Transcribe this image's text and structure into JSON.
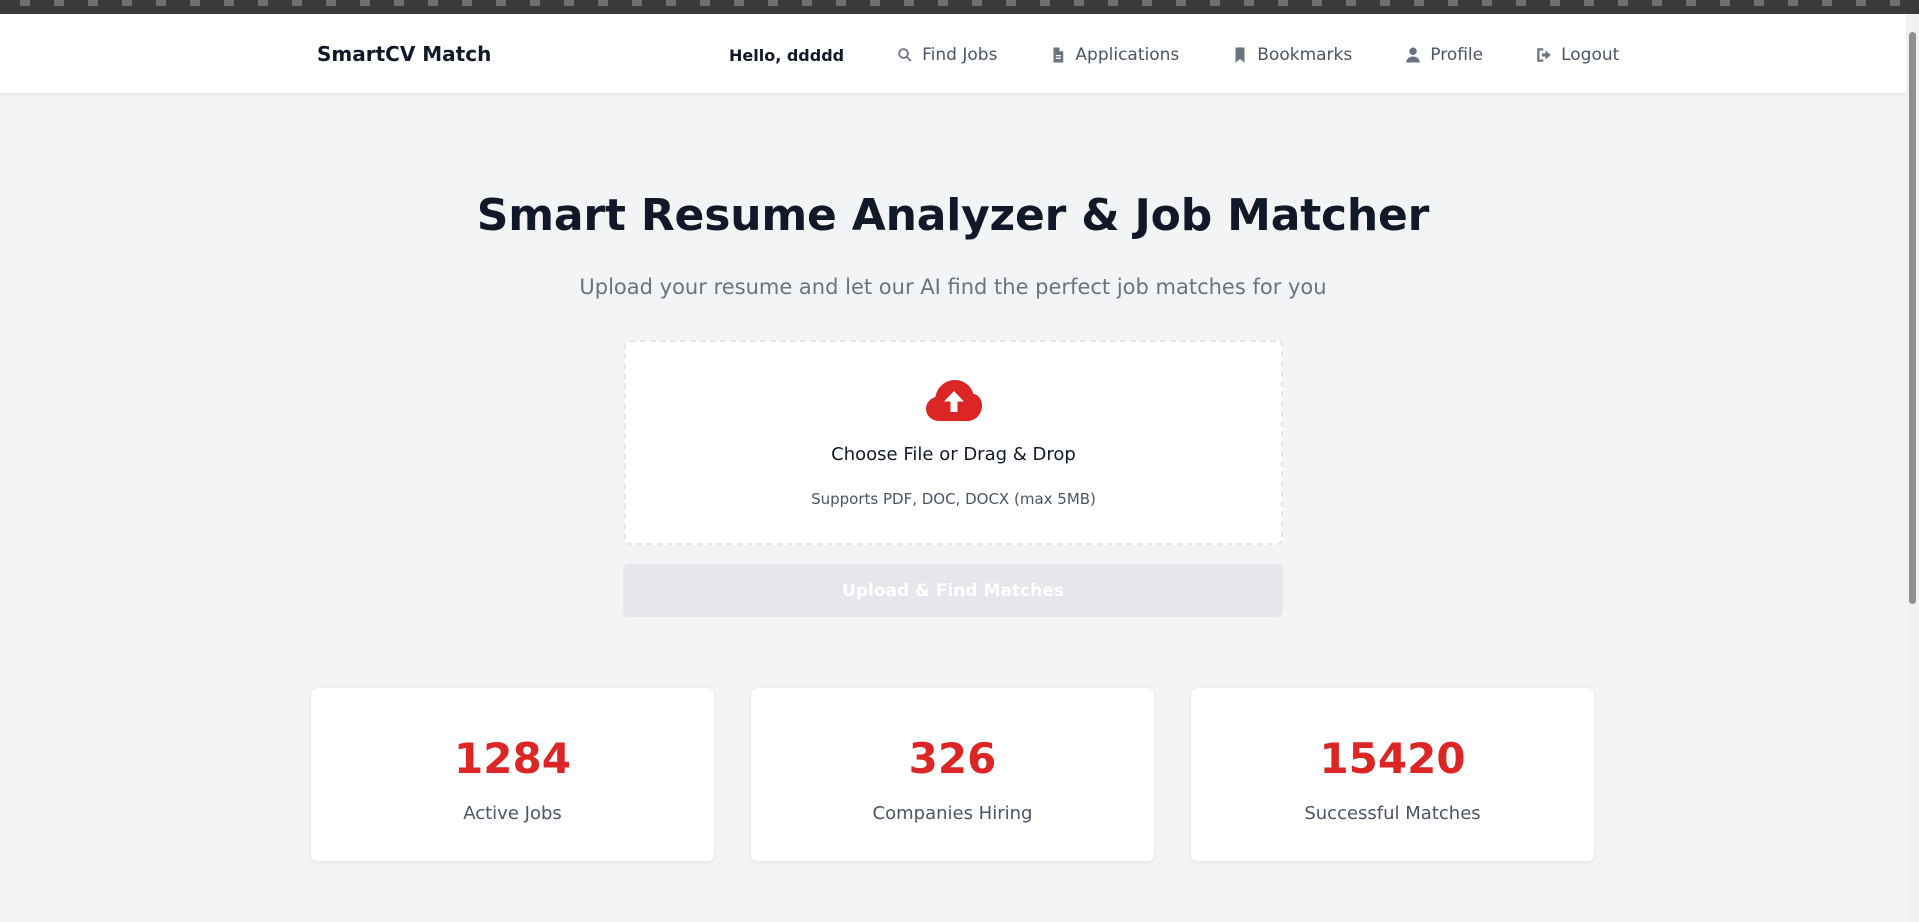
{
  "header": {
    "brand": "SmartCV Match",
    "greeting": "Hello, ddddd",
    "nav": [
      {
        "label": "Find Jobs",
        "icon": "search-icon"
      },
      {
        "label": "Applications",
        "icon": "document-icon"
      },
      {
        "label": "Bookmarks",
        "icon": "bookmark-icon"
      },
      {
        "label": "Profile",
        "icon": "user-icon"
      },
      {
        "label": "Logout",
        "icon": "logout-icon"
      }
    ]
  },
  "hero": {
    "title": "Smart Resume Analyzer & Job Matcher",
    "subtitle": "Upload your resume and let our AI find the perfect job matches for you"
  },
  "upload": {
    "icon": "cloud-upload-icon",
    "prompt": "Choose File or Drag & Drop",
    "supports": "Supports PDF, DOC, DOCX (max 5MB)",
    "button_label": "Upload & Find Matches"
  },
  "stats": [
    {
      "value": "1284",
      "label": "Active Jobs"
    },
    {
      "value": "326",
      "label": "Companies Hiring"
    },
    {
      "value": "15420",
      "label": "Successful Matches"
    }
  ],
  "colors": {
    "accent": "#dc2626",
    "background": "#f3f4f6",
    "text": "#111827",
    "muted": "#6b7280",
    "button_disabled": "#e5e7eb"
  }
}
